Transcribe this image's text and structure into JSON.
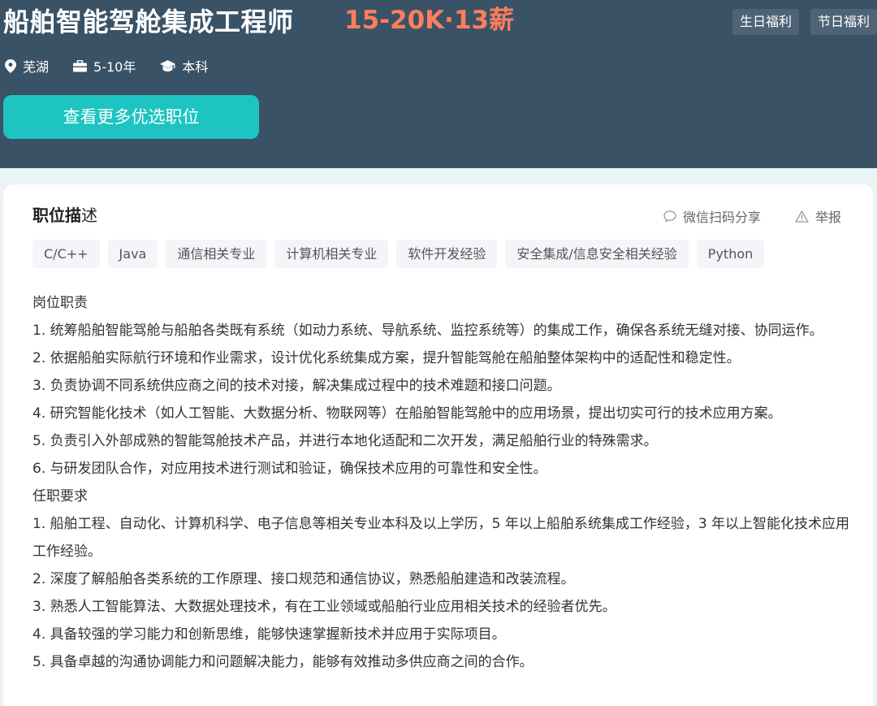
{
  "job": {
    "title": "船舶智能驾舱集成工程师",
    "salary": "15-20K·13薪",
    "welfare": [
      "生日福利",
      "节日福利"
    ],
    "location": "芜湖",
    "experience": "5-10年",
    "education": "本科",
    "more_button": "查看更多优选职位"
  },
  "section": {
    "title_bold": "职位描",
    "title_light": "述",
    "share_label": "微信扫码分享",
    "report_label": "举报"
  },
  "tags": [
    "C/C++",
    "Java",
    "通信相关专业",
    "计算机相关专业",
    "软件开发经验",
    "安全集成/信息安全相关经验",
    "Python"
  ],
  "description": [
    "岗位职责",
    "1. 统筹船舶智能驾舱与船舶各类既有系统（如动力系统、导航系统、监控系统等）的集成工作，确保各系统无缝对接、协同运作。",
    "2. 依据船舶实际航行环境和作业需求，设计优化系统集成方案，提升智能驾舱在船舶整体架构中的适配性和稳定性。",
    "3. 负责协调不同系统供应商之间的技术对接，解决集成过程中的技术难题和接口问题。",
    "4. 研究智能化技术（如人工智能、大数据分析、物联网等）在船舶智能驾舱中的应用场景，提出切实可行的技术应用方案。",
    "5. 负责引入外部成熟的智能驾舱技术产品，并进行本地化适配和二次开发，满足船舶行业的特殊需求。",
    "6. 与研发团队合作，对应用技术进行测试和验证，确保技术应用的可靠性和安全性。",
    "任职要求",
    "1. 船舶工程、自动化、计算机科学、电子信息等相关专业本科及以上学历，5 年以上船舶系统集成工作经验，3 年以上智能化技术应用工作经验。",
    "2. 深度了解船舶各类系统的工作原理、接口规范和通信协议，熟悉船舶建造和改装流程。",
    "3. 熟悉人工智能算法、大数据处理技术，有在工业领域或船舶行业应用相关技术的经验者优先。",
    "4. 具备较强的学习能力和创新思维，能够快速掌握新技术并应用于实际项目。",
    "5. 具备卓越的沟通协调能力和问题解决能力，能够有效推动多供应商之间的合作。"
  ],
  "icons": {
    "location": "location-pin-icon",
    "experience": "briefcase-icon",
    "education": "graduation-cap-icon",
    "share": "chat-bubble-icon",
    "report": "warning-icon"
  },
  "colors": {
    "header_bg": "#3a5266",
    "salary": "#ff7e5c",
    "button": "#1dc4c2",
    "page_bg": "#eaf4f6"
  }
}
